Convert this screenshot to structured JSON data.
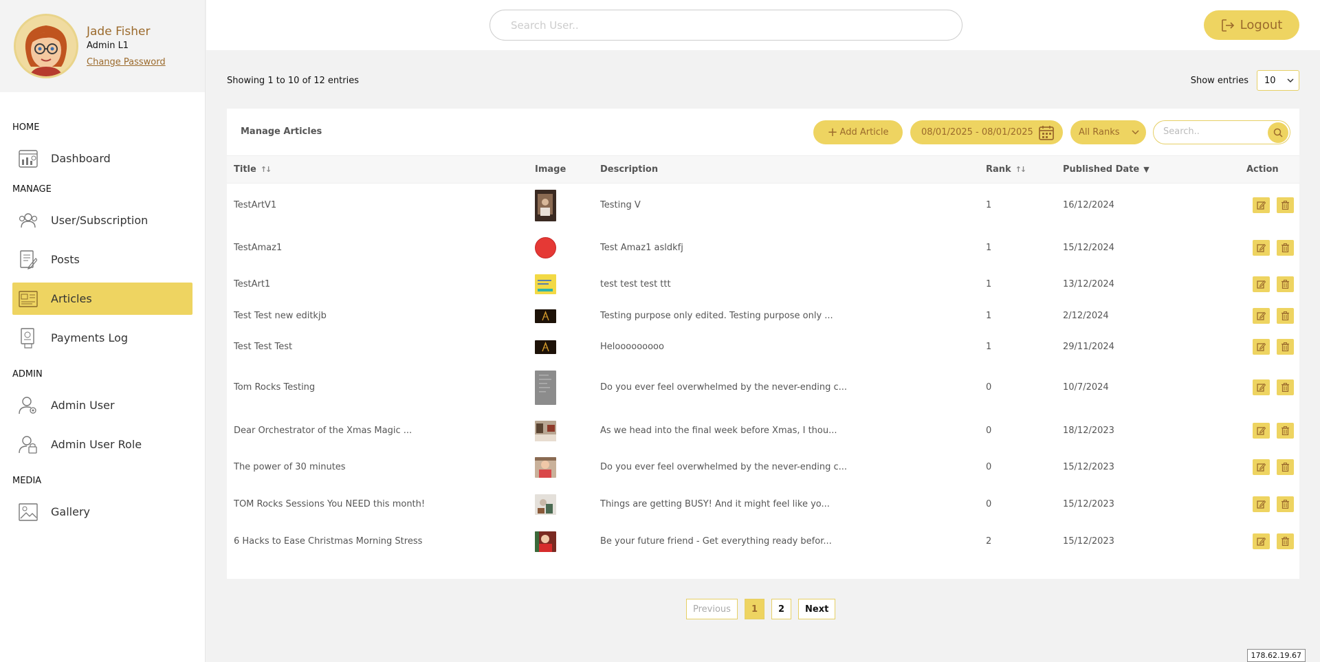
{
  "profile": {
    "name": "Jade Fisher",
    "role": "Admin L1",
    "change_password": "Change Password"
  },
  "nav": {
    "sections": [
      {
        "label": "HOME",
        "items": [
          {
            "label": "Dashboard",
            "icon": "dashboard-icon"
          }
        ]
      },
      {
        "label": "MANAGE",
        "items": [
          {
            "label": "User/Subscription",
            "icon": "users-icon"
          },
          {
            "label": "Posts",
            "icon": "posts-icon"
          },
          {
            "label": "Articles",
            "icon": "articles-icon",
            "active": true
          },
          {
            "label": "Payments Log",
            "icon": "payments-icon"
          }
        ]
      },
      {
        "label": "ADMIN",
        "items": [
          {
            "label": "Admin User",
            "icon": "admin-user-icon"
          },
          {
            "label": "Admin User Role",
            "icon": "admin-role-icon"
          }
        ]
      },
      {
        "label": "MEDIA",
        "items": [
          {
            "label": "Gallery",
            "icon": "gallery-icon"
          }
        ]
      }
    ]
  },
  "header": {
    "search_placeholder": "Search User..",
    "logout_label": "Logout"
  },
  "main": {
    "entries_info": "Showing 1 to 10 of 12 entries",
    "show_entries_label": "Show entries",
    "show_entries_value": "10",
    "card_title": "Manage Articles",
    "add_label": "Add Article",
    "date_range": "08/01/2025 - 08/01/2025",
    "rank_filter": "All Ranks",
    "search_placeholder": "Search.."
  },
  "table": {
    "columns": {
      "title": "Title",
      "image": "Image",
      "description": "Description",
      "rank": "Rank",
      "published": "Published Date",
      "action": "Action"
    },
    "rows": [
      {
        "title": "TestArtV1",
        "description": "Testing V",
        "rank": "1",
        "date": "16/12/2024",
        "thumb": "photo-tall",
        "h": 64
      },
      {
        "title": "TestAmaz1",
        "description": "Test Amaz1 asldkfj",
        "rank": "1",
        "date": "15/12/2024",
        "thumb": "red-circle",
        "h": 60
      },
      {
        "title": "TestArt1",
        "description": "test test test ttt",
        "rank": "1",
        "date": "13/12/2024",
        "thumb": "yellow-banner",
        "h": 46
      },
      {
        "title": "Test Test new editkjb",
        "description": "Testing purpose only edited. Testing purpose only ...",
        "rank": "1",
        "date": "2/12/2024",
        "thumb": "dark-logo",
        "h": 46
      },
      {
        "title": "Test Test Test",
        "description": "Helooooooooo",
        "rank": "1",
        "date": "29/11/2024",
        "thumb": "dark-logo",
        "h": 44
      },
      {
        "title": "Tom Rocks Testing",
        "description": "Do you ever feel overwhelmed by the never-ending c...",
        "rank": "0",
        "date": "10/7/2024",
        "thumb": "grey-doc",
        "h": 74
      },
      {
        "title": "Dear Orchestrator of the Xmas Magic ...",
        "description": "As we head into the final week before Xmas, I thou...",
        "rank": "0",
        "date": "18/12/2023",
        "thumb": "photo-room",
        "h": 52
      },
      {
        "title": "The power of 30 minutes",
        "description": "Do you ever feel overwhelmed by the never-ending c...",
        "rank": "0",
        "date": "15/12/2023",
        "thumb": "photo-person",
        "h": 54
      },
      {
        "title": "TOM Rocks Sessions You NEED this month!",
        "description": "Things are getting BUSY! And it might feel like yo...",
        "rank": "0",
        "date": "15/12/2023",
        "thumb": "photo-light",
        "h": 54
      },
      {
        "title": "6 Hacks to Ease Christmas Morning Stress",
        "description": "Be your future friend - Get everything ready befor...",
        "rank": "2",
        "date": "15/12/2023",
        "thumb": "photo-red",
        "h": 54
      }
    ]
  },
  "pagination": {
    "previous": "Previous",
    "pages": [
      "1",
      "2"
    ],
    "current": "1",
    "next": "Next"
  },
  "footer": {
    "ip": "178.62.19.67"
  },
  "colors": {
    "accent": "#eed461",
    "accent_text": "#9b6a2c",
    "background": "#f2f2f2"
  }
}
